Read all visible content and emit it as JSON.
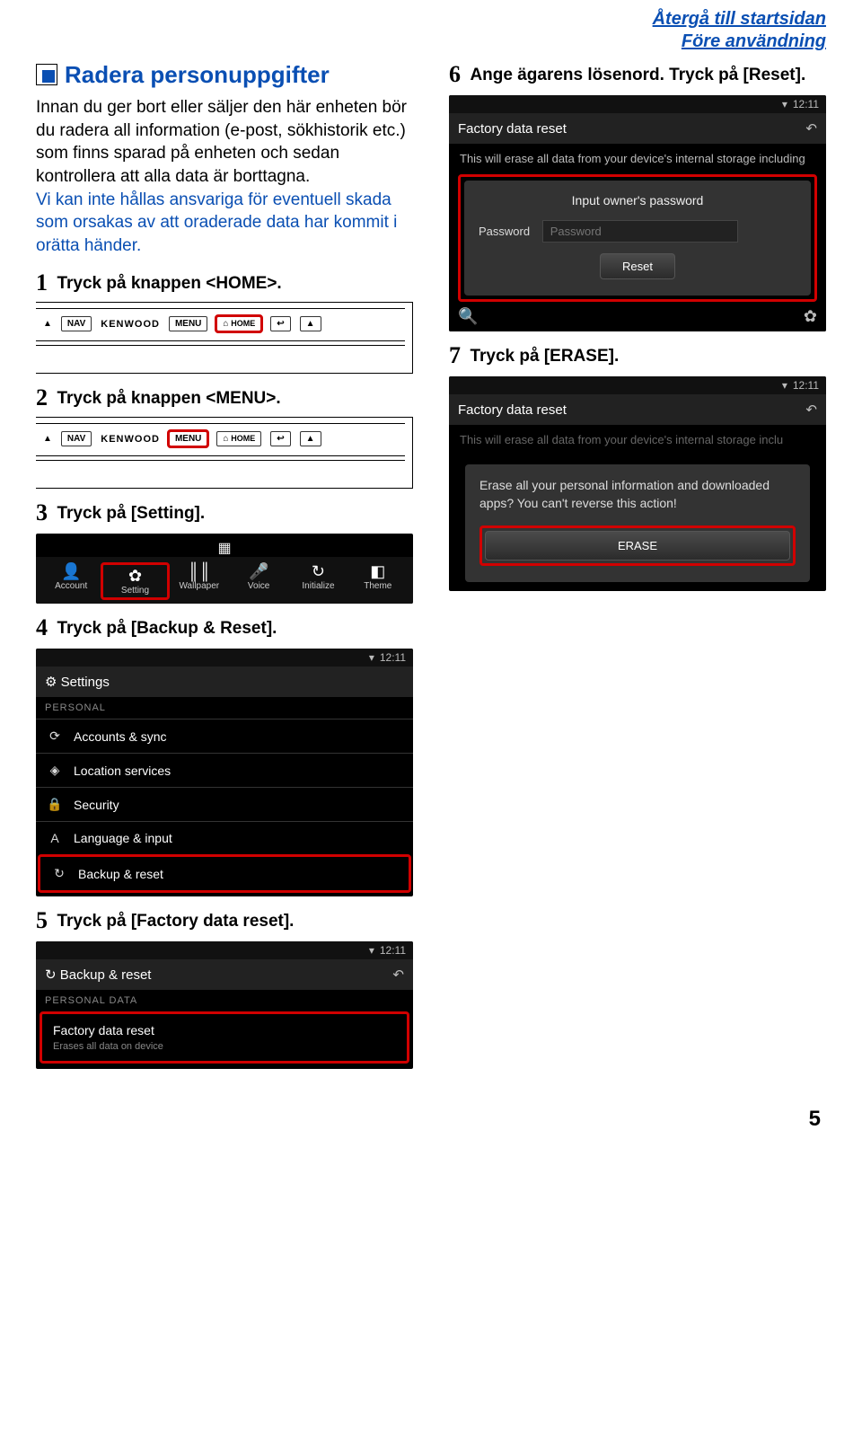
{
  "nav": {
    "home": "Återgå till startsidan",
    "before_use": "Före användning"
  },
  "section_title": "Radera personuppgifter",
  "intro_black": "Innan du ger bort eller säljer den här enheten bör du radera all information (e-post, sökhistorik etc.) som finns sparad på enheten och sedan kontrollera att alla data är borttagna.",
  "intro_blue": "Vi kan inte hållas ansvariga för eventuell skada som orsakas av att oraderade data har kommit i orätta händer.",
  "steps": {
    "s1": "Tryck på knappen <HOME>.",
    "s2": "Tryck på knappen <MENU>.",
    "s3": "Tryck på [Setting].",
    "s4": "Tryck på [Backup & Reset].",
    "s5": "Tryck på [Factory data reset].",
    "s6": "Ange ägarens lösenord. Tryck på [Reset].",
    "s7": "Tryck på [ERASE]."
  },
  "hw": {
    "nav": "NAV",
    "brand": "KENWOOD",
    "menu": "MENU",
    "home": "HOME"
  },
  "toolbar": {
    "account": "Account",
    "setting": "Setting",
    "wallpaper": "Wallpaper",
    "voice": "Voice",
    "initialize": "Initialize",
    "theme": "Theme"
  },
  "time": "12:11",
  "settings_screen": {
    "title": "Settings",
    "section": "PERSONAL",
    "rows": {
      "accounts": "Accounts & sync",
      "location": "Location services",
      "security": "Security",
      "language": "Language & input",
      "backup": "Backup & reset"
    }
  },
  "backup_screen": {
    "title": "Backup & reset",
    "section": "PERSONAL DATA",
    "row_title": "Factory data reset",
    "row_sub": "Erases all data on device"
  },
  "reset_screen": {
    "title": "Factory data reset",
    "body": "This will erase all data from your device's internal storage including",
    "dialog_title": "Input owner's password",
    "pwd_label": "Password",
    "pwd_placeholder": "Password",
    "reset_btn": "Reset"
  },
  "erase_screen": {
    "title": "Factory data reset",
    "body_prefix": "This will erase all data from your device's internal storage inclu",
    "dialog_msg": "Erase all your personal information and downloaded apps? You can't reverse this action!",
    "erase_btn": "ERASE"
  },
  "page_number": "5"
}
